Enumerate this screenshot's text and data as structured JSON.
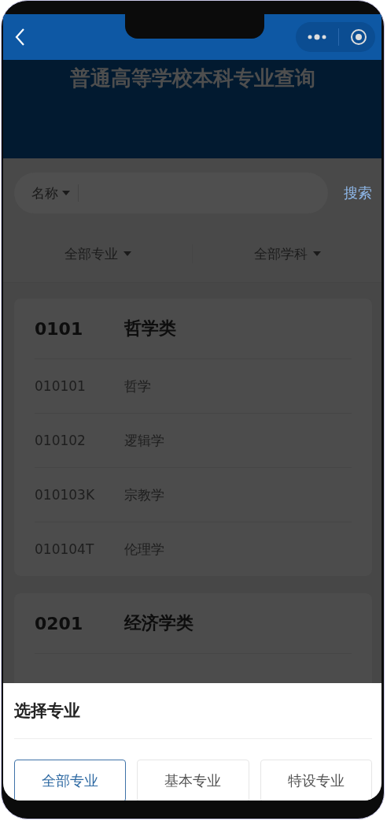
{
  "title": "普通高等学校本科专业查询",
  "search": {
    "scope": "名称",
    "action": "搜索"
  },
  "filters": [
    {
      "label": "全部专业"
    },
    {
      "label": "全部学科"
    }
  ],
  "groups": [
    {
      "code": "0101",
      "name": "哲学类",
      "majors": [
        {
          "code": "010101",
          "name": "哲学"
        },
        {
          "code": "010102",
          "name": "逻辑学"
        },
        {
          "code": "010103K",
          "name": "宗教学"
        },
        {
          "code": "010104T",
          "name": "伦理学"
        }
      ]
    },
    {
      "code": "0201",
      "name": "经济学类"
    }
  ],
  "sheet": {
    "title": "选择专业",
    "options": [
      {
        "label": "全部专业",
        "selected": true
      },
      {
        "label": "基本专业",
        "selected": false
      },
      {
        "label": "特设专业",
        "selected": false
      }
    ]
  }
}
